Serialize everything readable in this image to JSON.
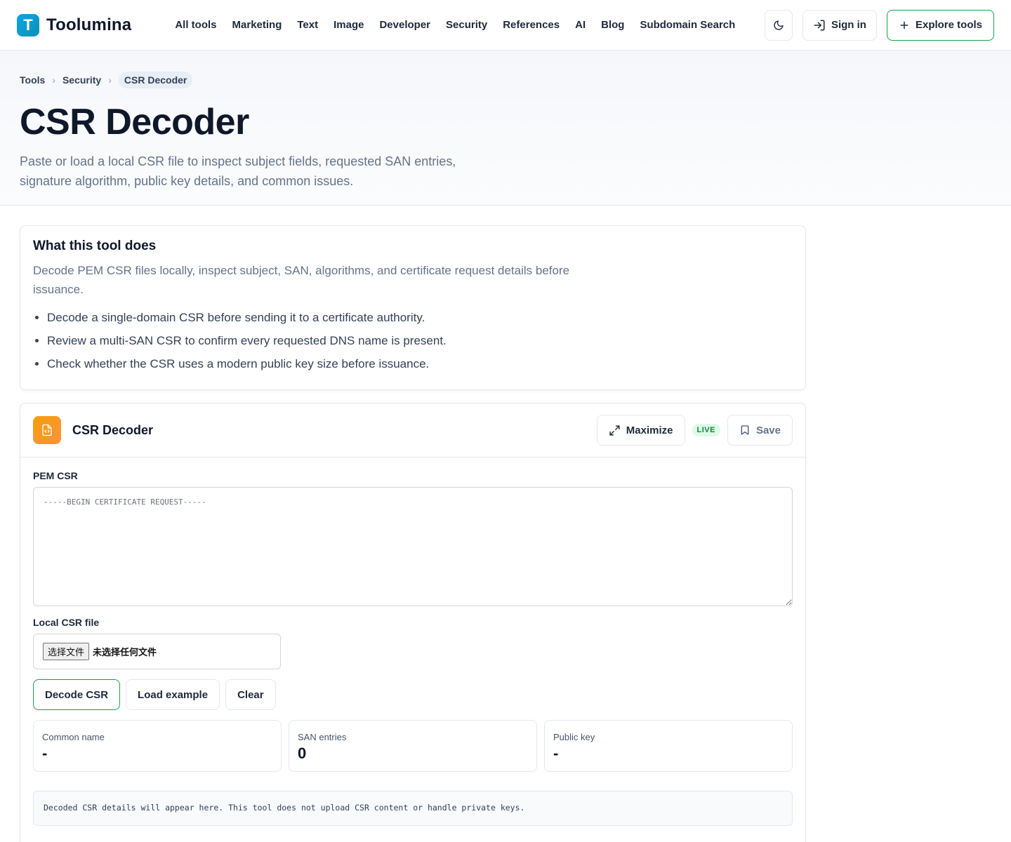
{
  "brand": {
    "logo_letter": "T",
    "name": "Toolumina"
  },
  "nav": [
    {
      "label": "All tools"
    },
    {
      "label": "Marketing"
    },
    {
      "label": "Text"
    },
    {
      "label": "Image"
    },
    {
      "label": "Developer"
    },
    {
      "label": "Security"
    },
    {
      "label": "References"
    },
    {
      "label": "AI"
    },
    {
      "label": "Blog"
    },
    {
      "label": "Subdomain Search"
    }
  ],
  "header_actions": {
    "theme_icon": "moon-icon",
    "signin_label": "Sign in",
    "explore_label": "Explore tools"
  },
  "breadcrumb": {
    "root": "Tools",
    "section": "Security",
    "current": "CSR Decoder"
  },
  "hero": {
    "title": "CSR Decoder",
    "description": "Paste or load a local CSR file to inspect subject fields, requested SAN entries, signature algorithm, public key details, and common issues."
  },
  "what": {
    "heading": "What this tool does",
    "summary": "Decode PEM CSR files locally, inspect subject, SAN, algorithms, and certificate request details before issuance.",
    "bullets": [
      "Decode a single-domain CSR before sending it to a certificate authority.",
      "Review a multi-SAN CSR to confirm every requested DNS name is present.",
      "Check whether the CSR uses a modern public key size before issuance."
    ]
  },
  "tool": {
    "title": "CSR Decoder",
    "maximize_label": "Maximize",
    "live_badge": "LIVE",
    "save_label": "Save",
    "pem_label": "PEM CSR",
    "pem_placeholder": "-----BEGIN CERTIFICATE REQUEST-----",
    "pem_value": "",
    "file_label": "Local CSR file",
    "file_button": "选择文件",
    "file_status": "未选择任何文件",
    "decode_label": "Decode CSR",
    "example_label": "Load example",
    "clear_label": "Clear",
    "stats": [
      {
        "label": "Common name",
        "value": "-"
      },
      {
        "label": "SAN entries",
        "value": "0"
      },
      {
        "label": "Public key",
        "value": "-"
      }
    ],
    "output_text": "Decoded CSR details will appear here. This tool does not upload CSR content or handle private keys."
  },
  "colors": {
    "accent_green": "#16a34a",
    "logo_blue": "#0ea5e9",
    "tool_icon_orange": "#f59e0b",
    "live_badge_bg": "#dcfce7"
  }
}
